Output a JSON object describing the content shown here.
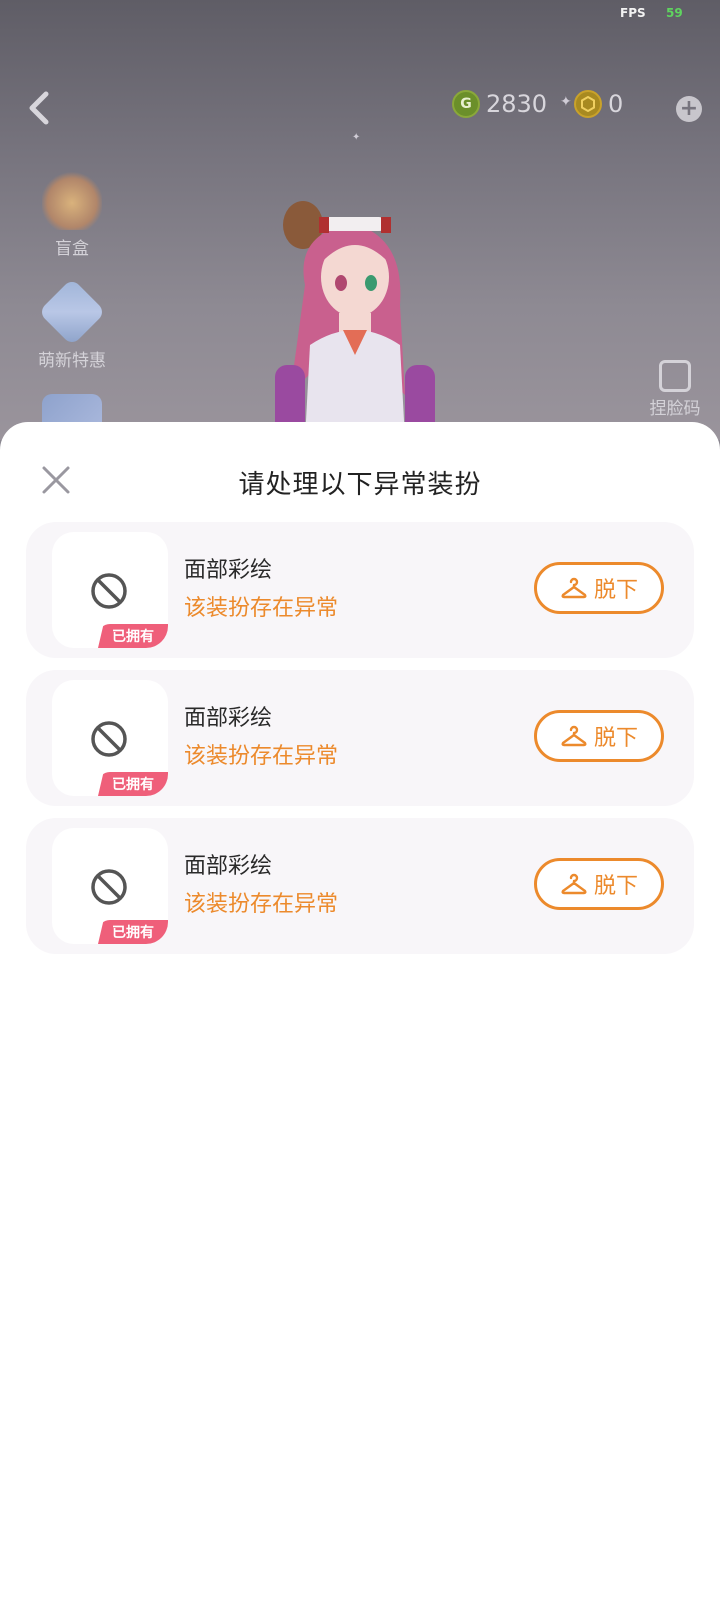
{
  "hud": {
    "fps_label": "FPS",
    "fps_value": "59",
    "gcoin_value": "2830",
    "hcoin_value": "0",
    "gcoin_symbol": "G"
  },
  "sidebar": {
    "items": [
      {
        "label": "盲盒",
        "icon": "gift-box-icon"
      },
      {
        "label": "萌新特惠",
        "icon": "newbie-deal-icon"
      }
    ],
    "faceid_label": "捏脸码"
  },
  "dialog": {
    "title": "请处理以下异常装扮",
    "items": [
      {
        "name": "面部彩绘",
        "status": "该装扮存在异常",
        "badge": "已拥有",
        "action": "脱下"
      },
      {
        "name": "面部彩绘",
        "status": "该装扮存在异常",
        "badge": "已拥有",
        "action": "脱下"
      },
      {
        "name": "面部彩绘",
        "status": "该装扮存在异常",
        "badge": "已拥有",
        "action": "脱下"
      }
    ]
  },
  "colors": {
    "accent": "#ec8a2c",
    "badge": "#ef5f7a",
    "card_bg": "#f8f6f9"
  }
}
